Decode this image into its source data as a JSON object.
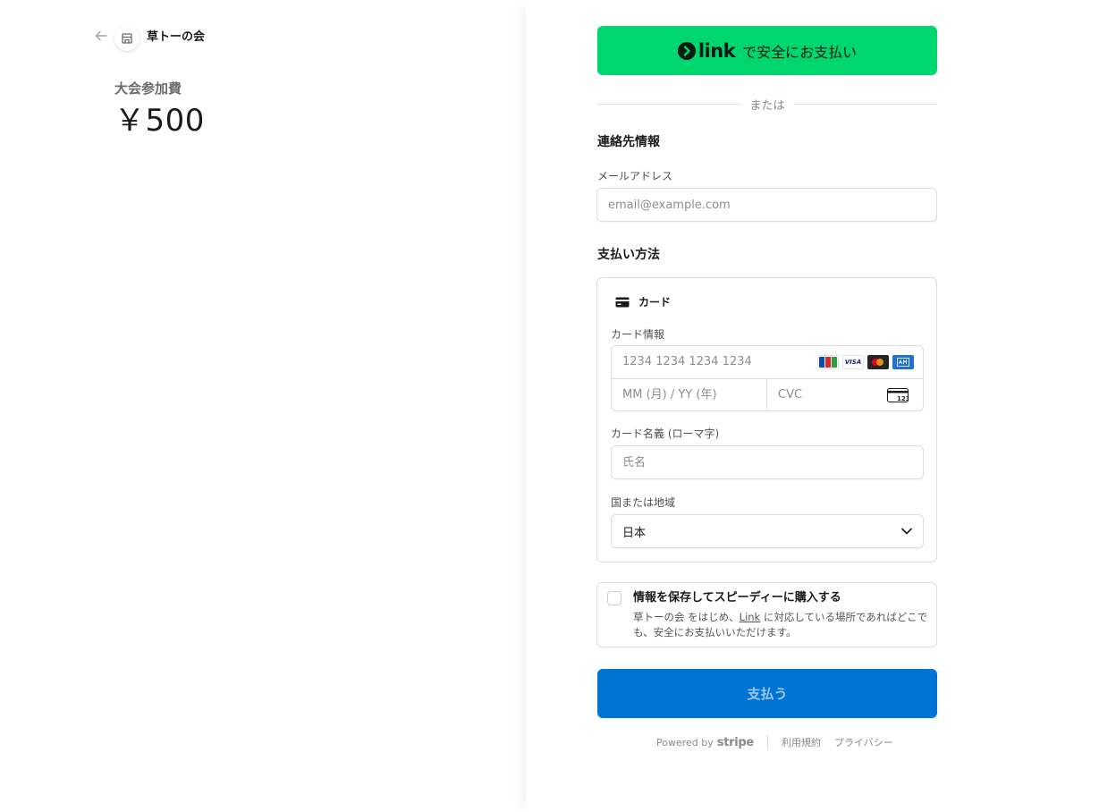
{
  "merchant": {
    "name": "草トーの会",
    "product": "大会参加費",
    "price": "￥500"
  },
  "link_button": {
    "logo_text": "link",
    "label": "で安全にお支払い"
  },
  "divider_text": "または",
  "contact": {
    "title": "連絡先情報",
    "email_label": "メールアドレス",
    "email_placeholder": "email@example.com"
  },
  "payment": {
    "title": "支払い方法",
    "tab_card_label": "カード",
    "card_info_label": "カード情報",
    "card_number_placeholder": "1234 1234 1234 1234",
    "expiry_placeholder": "MM (月) / YY (年)",
    "cvc_placeholder": "CVC",
    "cvc_icon_text": "123",
    "brands": [
      "JCB",
      "VISA",
      "Mastercard",
      "American Express"
    ],
    "name_label": "カード名義 (ローマ字)",
    "name_placeholder": "氏名",
    "country_label": "国または地域",
    "country_value": "日本"
  },
  "save_info": {
    "title": "情報を保存してスピーディーに購入する",
    "desc_before": "草トーの会 をはじめ、",
    "desc_link": "Link",
    "desc_after": " に対応している場所であればどこでも、安全にお支払いいただけます。"
  },
  "pay_button": {
    "label": "支払う"
  },
  "footer": {
    "powered_by": "Powered by",
    "stripe": "stripe",
    "terms": "利用規約",
    "privacy": "プライバシー"
  },
  "colors": {
    "link_green": "#00d66f",
    "pay_blue": "#0074d4",
    "border": "#dcdcdc"
  }
}
